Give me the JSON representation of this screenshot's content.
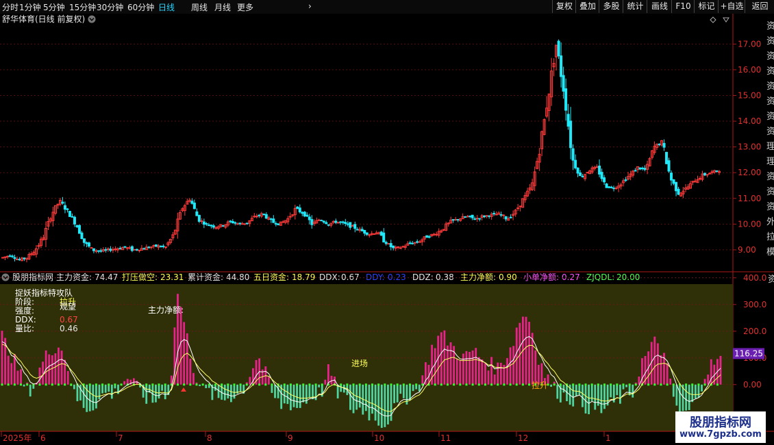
{
  "topbar": {
    "periods": [
      "分时",
      "1分钟",
      "5分钟",
      "15分钟",
      "30分钟",
      "60分钟",
      "日线",
      "周线",
      "月线",
      "更多"
    ],
    "active_period": "日线",
    "more_arrow": "›",
    "right_buttons": [
      "复权",
      "叠加",
      "多股",
      "统计",
      "画线",
      "F10",
      "标记",
      "+自选",
      "返回"
    ]
  },
  "stock": {
    "title": "舒华体育(日线 前复权)",
    "price_axis": [
      "17.00",
      "16.00",
      "15.00",
      "14.00",
      "13.00",
      "12.00",
      "11.00",
      "10.00",
      "9.00"
    ],
    "price_range": [
      8.2,
      17.7
    ]
  },
  "right_edge_chars": [
    "资",
    "资",
    "资",
    "资",
    "资",
    "资",
    "资",
    "资",
    "理",
    "理",
    "资",
    "资",
    "资",
    "外",
    "拉",
    "模"
  ],
  "indicator": {
    "name": "股朋指标网",
    "stats": [
      {
        "label": "主力资金:",
        "value": "74.47",
        "color": "#e6e6e6"
      },
      {
        "label": "打压做空:",
        "value": "23.31",
        "color": "#ffff55"
      },
      {
        "label": "累计资金:",
        "value": "44.80",
        "color": "#e6e6e6"
      },
      {
        "label": "五日资金:",
        "value": "18.79",
        "color": "#ffff55"
      },
      {
        "label": "DDX:",
        "value": "0.67",
        "color": "#e6e6e6"
      },
      {
        "label": "DDY:",
        "value": "0.23",
        "color": "#2f44ff"
      },
      {
        "label": "DDZ:",
        "value": "0.38",
        "color": "#e6e6e6"
      },
      {
        "label": "主力净额:",
        "value": "0.90",
        "color": "#ffff55"
      },
      {
        "label": "小单净额:",
        "value": "0.27",
        "color": "#ff55ff"
      },
      {
        "label": "ZJQDL:",
        "value": "20.00",
        "color": "#55ff55"
      }
    ],
    "side_char": "资",
    "axis": [
      "400.0",
      "300.0",
      "200.0",
      "100.0",
      "0.00"
    ],
    "axis_range": [
      -175,
      420
    ],
    "current_value": "116.25",
    "overlay": {
      "title": "捉妖指标特攻队",
      "stage_label": "阶段:",
      "stage_value": "拉升",
      "stage_overlap": "观望",
      "strength_label": "强度:",
      "ddx_label": "DDX:",
      "ddx_value": "0.67",
      "volratio_label": "量比:",
      "volratio_value": "0.46",
      "net_label": "主力净额:",
      "entry_label": "进场",
      "lift_label": "拉升"
    }
  },
  "time_axis": {
    "labels": [
      "2025年",
      "6",
      "7",
      "8",
      "9",
      "10",
      "11",
      "12",
      "1"
    ]
  },
  "watermark": {
    "title": "股朋指标网",
    "url": "www.7gpzb.com"
  },
  "chart_data": [
    {
      "type": "candlestick",
      "title": "舒华体育(日线 前复权)",
      "ylim": [
        8.2,
        17.7
      ],
      "y_ticks": [
        9,
        10,
        11,
        12,
        13,
        14,
        15,
        16,
        17
      ],
      "x_ticks": [
        "2025年",
        "6",
        "7",
        "8",
        "9",
        "10",
        "11",
        "12",
        "1"
      ],
      "close_path": [
        8.7,
        8.8,
        8.6,
        8.7,
        9.0,
        9.5,
        10.4,
        10.9,
        10.5,
        10.0,
        9.3,
        9.0,
        8.95,
        9.0,
        9.05,
        9.1,
        9.0,
        9.05,
        9.1,
        9.15,
        9.1,
        9.6,
        10.6,
        11.0,
        10.2,
        10.0,
        9.9,
        9.95,
        10.1,
        10.0,
        10.05,
        10.3,
        10.4,
        10.1,
        10.0,
        10.2,
        10.6,
        10.4,
        10.0,
        10.2,
        10.0,
        10.1,
        10.0,
        9.9,
        9.75,
        9.6,
        9.7,
        9.3,
        9.05,
        9.1,
        9.25,
        9.3,
        9.5,
        9.6,
        9.8,
        10.1,
        10.2,
        10.3,
        10.2,
        10.3,
        10.35,
        10.4,
        10.2,
        10.5,
        11.0,
        11.5,
        13.0,
        15.0,
        17.0,
        15.0,
        12.5,
        11.8,
        12.1,
        12.2,
        11.5,
        11.4,
        11.6,
        11.9,
        12.2,
        12.1,
        13.0,
        13.2,
        11.8,
        11.2,
        11.4,
        11.7,
        11.9,
        12.0,
        12.1
      ],
      "has_volume": false
    },
    {
      "type": "bar",
      "title": "股朋指标网",
      "ylim": [
        -175,
        420
      ],
      "y_ticks": [
        0,
        100,
        200,
        300,
        400
      ],
      "last_value": 116.25,
      "series_path": [
        180,
        120,
        60,
        -20,
        -10,
        80,
        130,
        150,
        100,
        -40,
        -80,
        -90,
        -60,
        -30,
        -40,
        10,
        30,
        -20,
        -50,
        -70,
        -30,
        -30,
        350,
        200,
        60,
        -20,
        -30,
        -60,
        -50,
        -40,
        -30,
        40,
        110,
        40,
        -50,
        -80,
        -70,
        -90,
        -60,
        -40,
        -30,
        60,
        -30,
        -50,
        -100,
        -90,
        -110,
        -130,
        -150,
        -100,
        -60,
        -40,
        -20,
        60,
        150,
        190,
        160,
        120,
        100,
        130,
        100,
        80,
        60,
        100,
        160,
        260,
        250,
        120,
        40,
        -10,
        -40,
        -50,
        -60,
        -80,
        -90,
        -100,
        -80,
        -60,
        -40,
        -30,
        80,
        120,
        170,
        100,
        -40,
        -120,
        -100,
        -60,
        40,
        80,
        90
      ]
    }
  ]
}
